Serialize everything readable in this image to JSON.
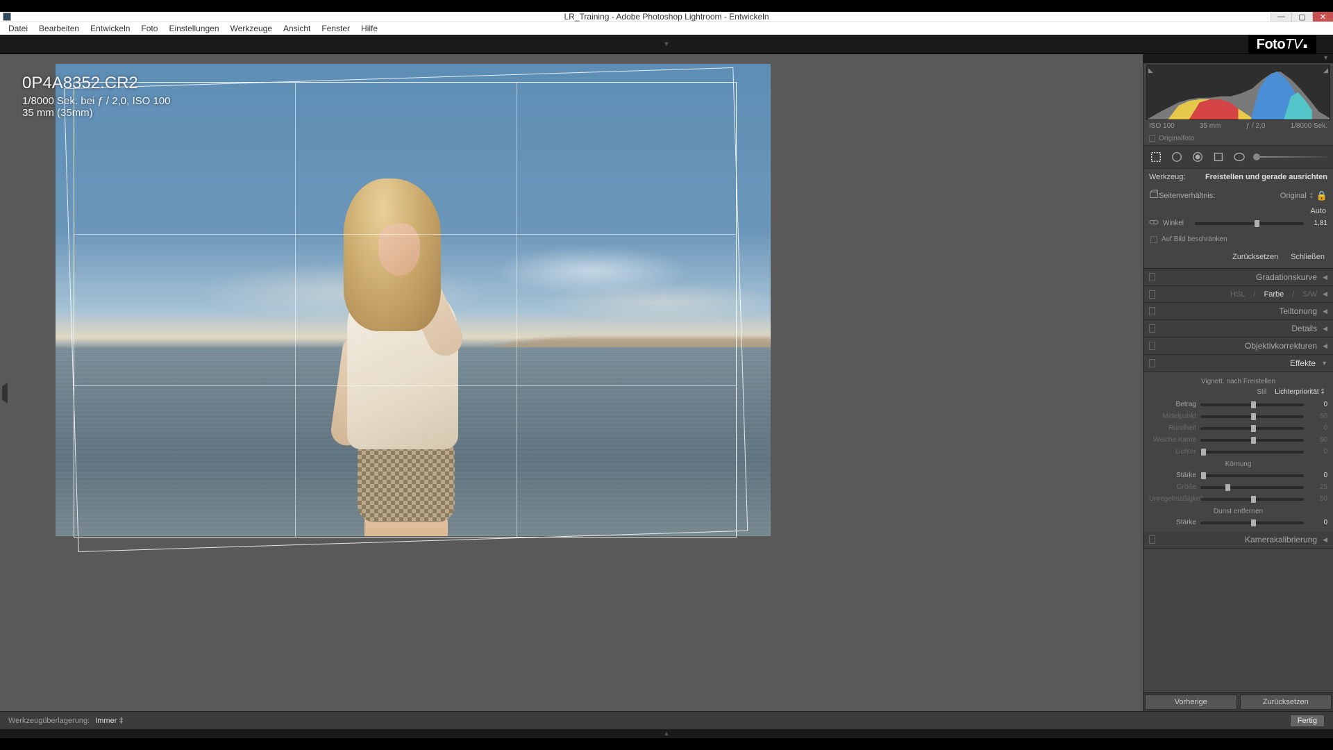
{
  "titlebar": {
    "title": "LR_Training - Adobe Photoshop Lightroom - Entwickeln"
  },
  "menu": {
    "items": [
      "Datei",
      "Bearbeiten",
      "Entwickeln",
      "Foto",
      "Einstellungen",
      "Werkzeuge",
      "Ansicht",
      "Fenster",
      "Hilfe"
    ]
  },
  "logo": {
    "foto": "Foto",
    "tv": "TV",
    "dot": "."
  },
  "overlay": {
    "filename": "0P4A8352.CR2",
    "meta1": "1/8000 Sek. bei ƒ / 2,0, ISO 100",
    "meta2": "35 mm (35mm)"
  },
  "histogram_meta": {
    "iso": "ISO 100",
    "focal": "35 mm",
    "aperture": "ƒ / 2,0",
    "shutter": "1/8000 Sek."
  },
  "originalfoto": {
    "label": "Originalfoto"
  },
  "tool": {
    "label": "Werkzeug:",
    "name": "Freistellen und gerade ausrichten"
  },
  "aspect": {
    "label": "Seitenverhältnis:",
    "value": "Original"
  },
  "auto": {
    "label": "Auto"
  },
  "angle": {
    "label": "Winkel",
    "value": "1,81"
  },
  "constrain": {
    "label": "Auf Bild beschränken"
  },
  "crop_buttons": {
    "reset": "Zurücksetzen",
    "close": "Schließen"
  },
  "panels": {
    "gradation": "Gradationskurve",
    "hsl": {
      "hsl": "HSL",
      "farbe": "Farbe",
      "sw": "S/W"
    },
    "teiltonung": "Teiltonung",
    "details": "Details",
    "objektiv": "Objektivkorrekturen",
    "effekte": "Effekte",
    "kamera": "Kamerakalibrierung"
  },
  "effects": {
    "vignette_title": "Vignett. nach Freistellen",
    "stil": {
      "label": "Stil",
      "value": "Lichterpriorität"
    },
    "betrag": {
      "label": "Betrag",
      "value": "0"
    },
    "mittelpunkt": {
      "label": "Mittelpunkt",
      "value": "50"
    },
    "rundheit": {
      "label": "Rundheit",
      "value": "0"
    },
    "weiche": {
      "label": "Weiche Kante",
      "value": "50"
    },
    "lichter": {
      "label": "Lichter",
      "value": "0"
    },
    "koernung_title": "Körnung",
    "staerke": {
      "label": "Stärke",
      "value": "0"
    },
    "groesse": {
      "label": "Größe",
      "value": "25"
    },
    "unregel": {
      "label": "Unregelmäßigkeit",
      "value": "50"
    },
    "dunst_title": "Dunst entfernen",
    "dunst_staerke": {
      "label": "Stärke",
      "value": "0"
    }
  },
  "bottom": {
    "overlay_label": "Werkzeugüberlagerung:",
    "overlay_value": "Immer",
    "done": "Fertig"
  },
  "rp_bottom": {
    "prev": "Vorherige",
    "reset": "Zurücksetzen"
  }
}
